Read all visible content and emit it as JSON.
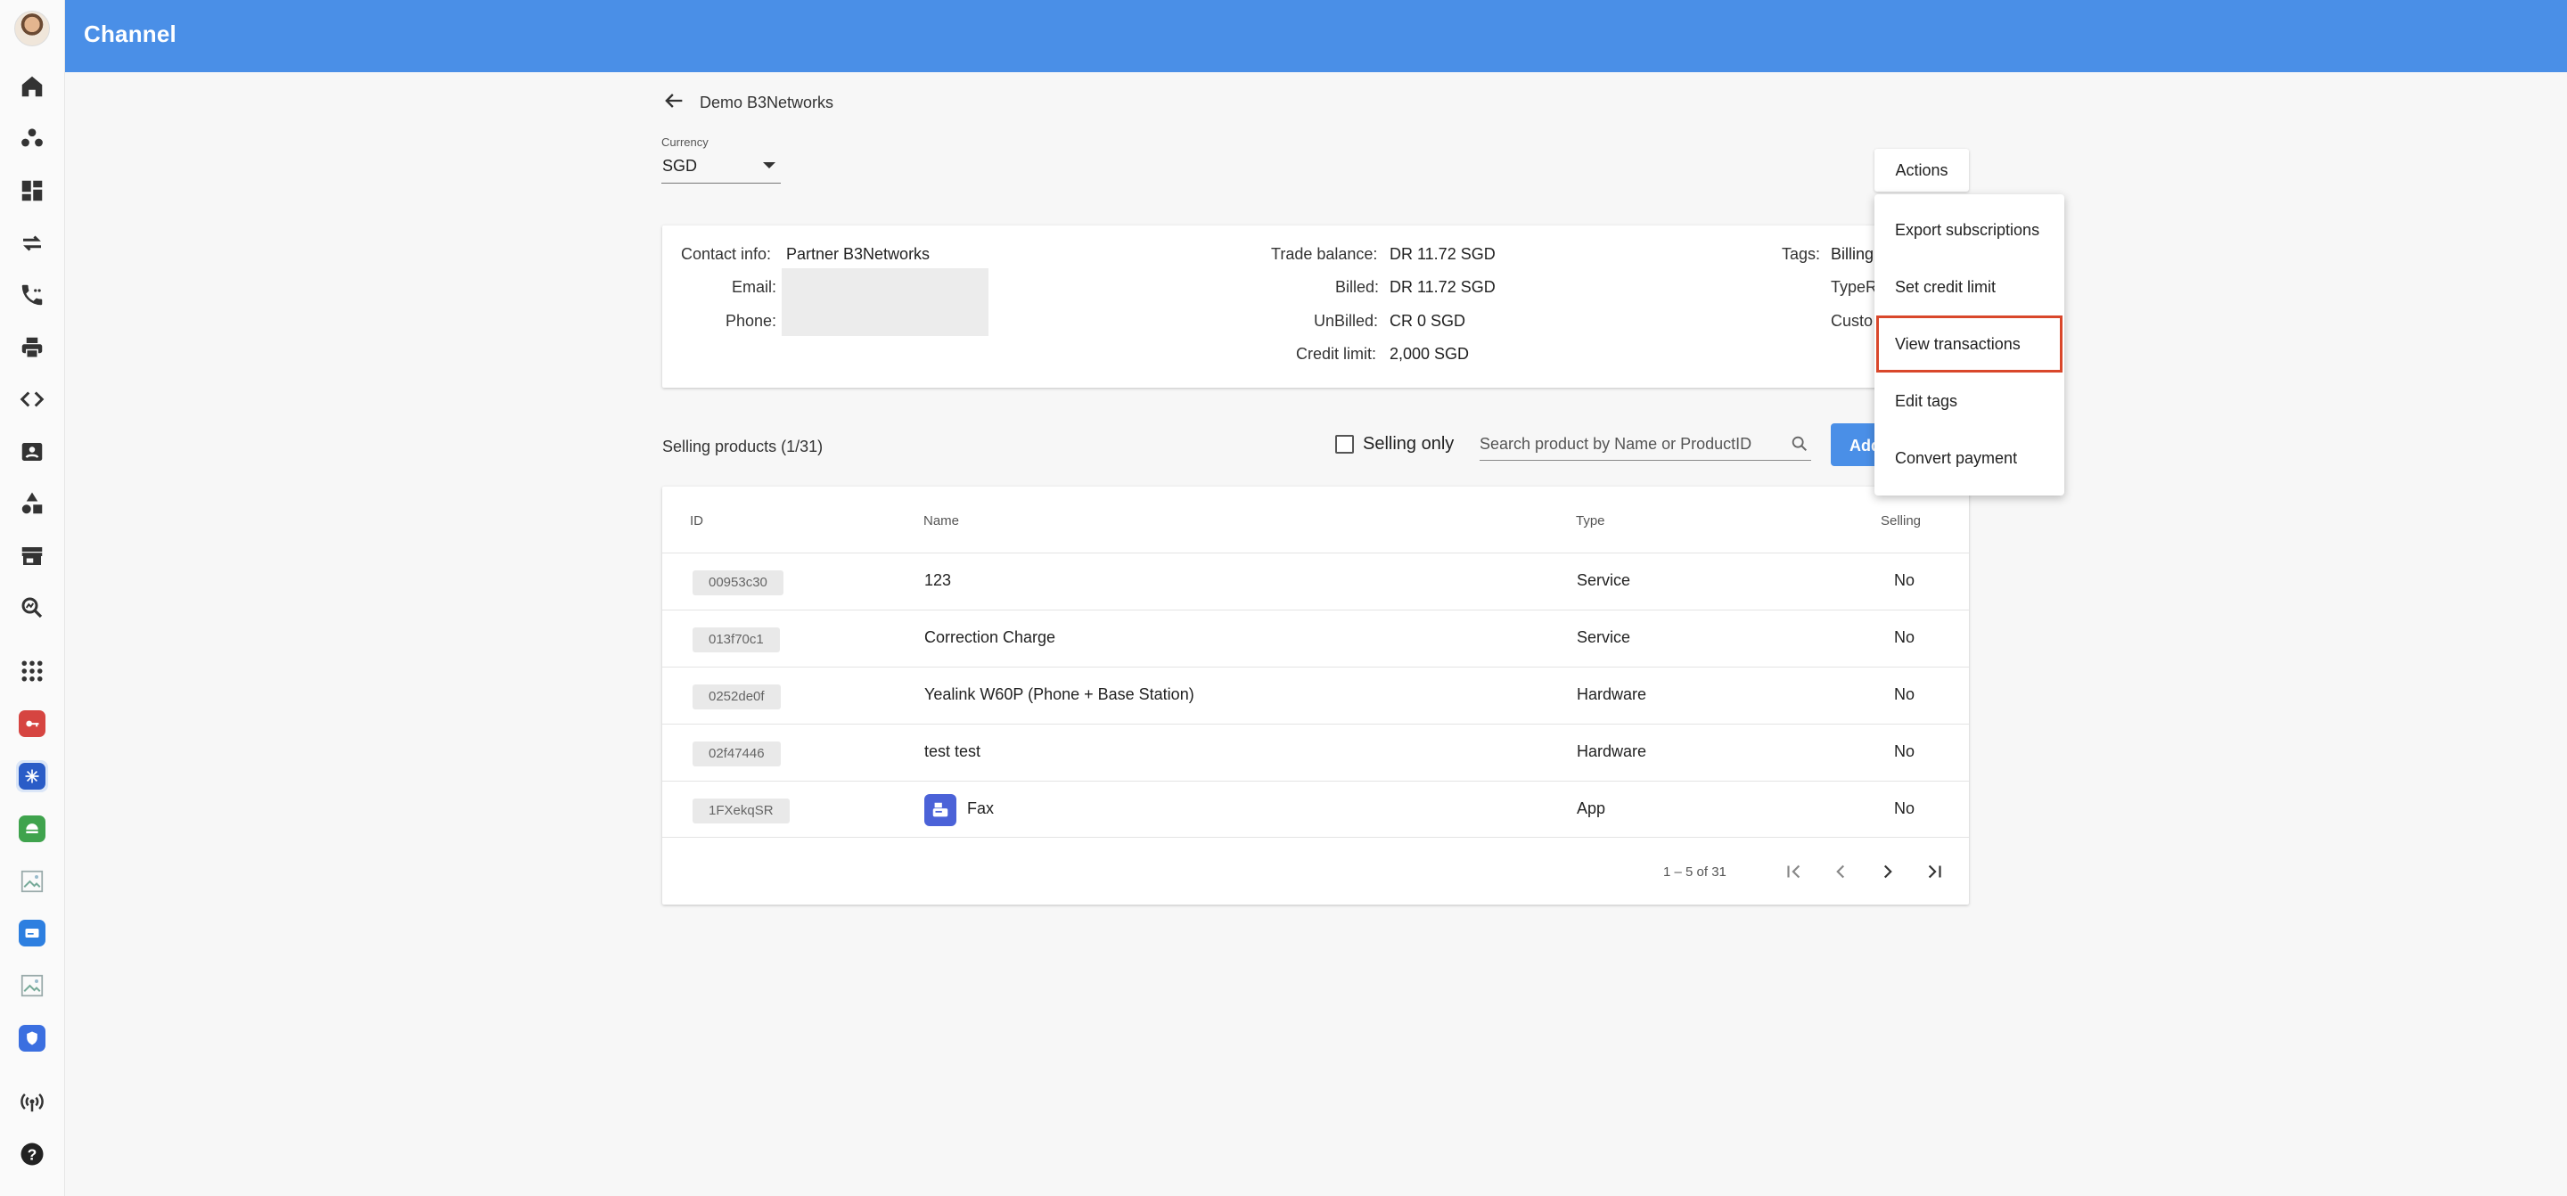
{
  "app": {
    "title": "Channel"
  },
  "rail": {
    "items": [
      {
        "name": "home-icon"
      },
      {
        "name": "people-icon"
      },
      {
        "name": "dashboard-icon"
      },
      {
        "name": "transfer-icon"
      },
      {
        "name": "phone-call-icon"
      },
      {
        "name": "printer-icon"
      },
      {
        "name": "code-icon"
      },
      {
        "name": "contact-card-icon"
      },
      {
        "name": "shapes-icon"
      },
      {
        "name": "store-icon"
      },
      {
        "name": "analytics-search-icon"
      },
      {
        "name": "apps-grid-icon"
      },
      {
        "name": "key-app-icon",
        "color": "#d64541"
      },
      {
        "name": "channel-app-icon",
        "color": "#2a5cc7"
      },
      {
        "name": "green-app-icon",
        "color": "#3fa34d"
      },
      {
        "name": "broken-image-icon"
      },
      {
        "name": "blue-card-app-icon",
        "color": "#2d7fe0"
      },
      {
        "name": "broken-image-icon"
      },
      {
        "name": "shield-app-icon",
        "color": "#3b6fe0"
      },
      {
        "name": "broadcast-icon"
      },
      {
        "name": "help-icon"
      }
    ]
  },
  "header": {
    "back_label": "back",
    "customer_name": "Demo B3Networks"
  },
  "currency": {
    "label": "Currency",
    "value": "SGD"
  },
  "info": {
    "contact_label": "Contact info:",
    "contact_value": "Partner B3Networks",
    "email_label": "Email:",
    "phone_label": "Phone:",
    "trade_balance_label": "Trade balance:",
    "trade_balance_value": "DR 11.72 SGD",
    "billed_label": "Billed:",
    "billed_value": "DR 11.72 SGD",
    "unbilled_label": "UnBilled:",
    "unbilled_value": "CR 0 SGD",
    "credit_limit_label": "Credit limit:",
    "credit_limit_value": "2,000 SGD",
    "tags_label": "Tags:",
    "tags_value": "Billing",
    "type_label": "TypeR",
    "custo_label": "Custo"
  },
  "products": {
    "title": "Selling products (1/31)",
    "selling_only_label": "Selling only",
    "search_placeholder": "Search product by Name or ProductID",
    "add_label": "Add",
    "columns": {
      "id": "ID",
      "name": "Name",
      "type": "Type",
      "selling": "Selling"
    },
    "rows": [
      {
        "id": "00953c30",
        "name": "123",
        "type": "Service",
        "selling": "No"
      },
      {
        "id": "013f70c1",
        "name": "Correction Charge",
        "type": "Service",
        "selling": "No"
      },
      {
        "id": "0252de0f",
        "name": "Yealink W60P (Phone + Base Station)",
        "type": "Hardware",
        "selling": "No"
      },
      {
        "id": "02f47446",
        "name": "test test",
        "type": "Hardware",
        "selling": "No"
      },
      {
        "id": "1FXekqSR",
        "name": "Fax",
        "type": "App",
        "selling": "No"
      }
    ],
    "pagination": "1 – 5 of 31"
  },
  "actions": {
    "label": "Actions",
    "menu": [
      "Export subscriptions",
      "Set credit limit",
      "View transactions",
      "Edit tags",
      "Convert payment"
    ],
    "highlighted": "View transactions",
    "highlight_color": "#d9472b"
  },
  "colors": {
    "primary": "#4a8fe7"
  }
}
